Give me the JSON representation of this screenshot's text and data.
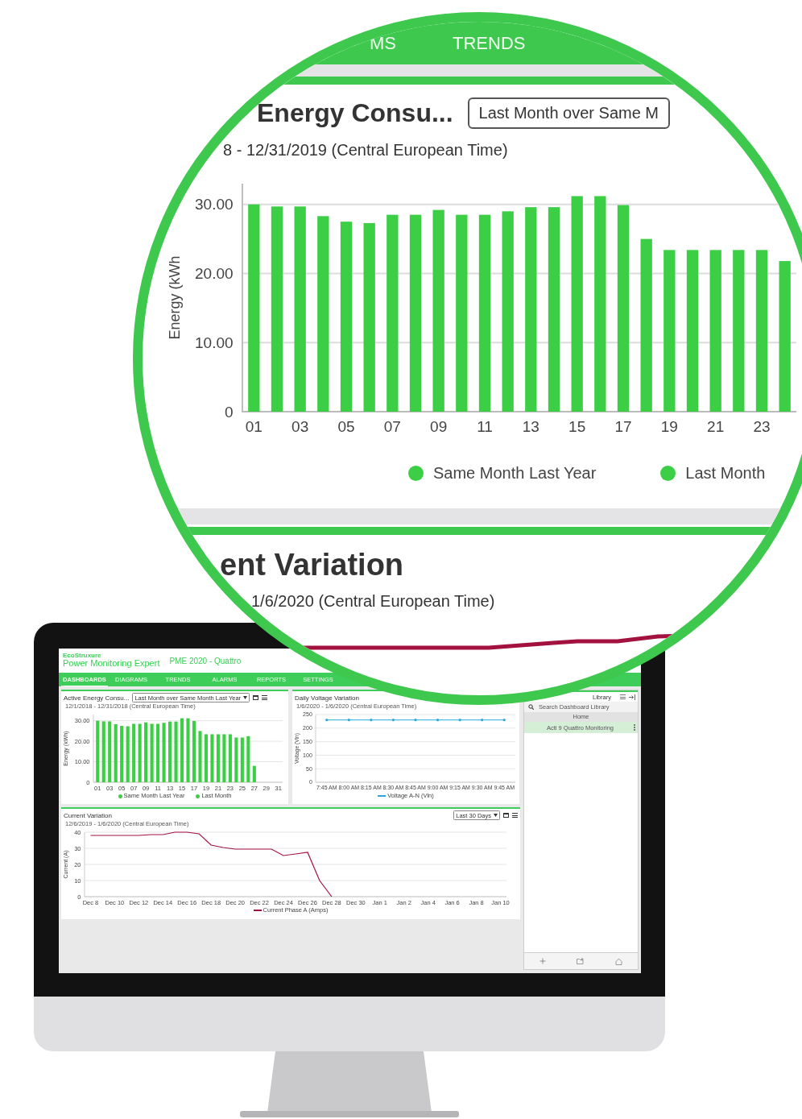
{
  "magnifier": {
    "nav_tabs": [
      {
        "label": "MS"
      },
      {
        "label": "TRENDS"
      }
    ],
    "energy_card": {
      "title": "Energy Consu...",
      "period_select": "Last Month over Same M",
      "date_range": "8 - 12/31/2019 (Central European Time)",
      "chart_data": {
        "type": "bar",
        "ylabel": "Energy (kWh",
        "grid": true,
        "x": [
          1,
          2,
          3,
          4,
          5,
          6,
          7,
          8,
          9,
          10,
          11,
          12,
          13,
          14,
          15,
          16,
          17,
          18,
          19,
          20,
          21,
          22,
          23,
          24
        ],
        "xlim": [
          0.5,
          24.5
        ],
        "ylim": [
          0,
          33
        ],
        "xticks": [
          {
            "value": 1,
            "label": "01"
          },
          {
            "value": 3,
            "label": "03"
          },
          {
            "value": 5,
            "label": "05"
          },
          {
            "value": 7,
            "label": "07"
          },
          {
            "value": 9,
            "label": "09"
          },
          {
            "value": 11,
            "label": "11"
          },
          {
            "value": 13,
            "label": "13"
          },
          {
            "value": 15,
            "label": "15"
          },
          {
            "value": 17,
            "label": "17"
          },
          {
            "value": 19,
            "label": "19"
          },
          {
            "value": 21,
            "label": "21"
          },
          {
            "value": 23,
            "label": "23"
          }
        ],
        "yticks": [
          {
            "value": 0,
            "label": "0"
          },
          {
            "value": 10,
            "label": "10.00"
          },
          {
            "value": 20,
            "label": "20.00"
          },
          {
            "value": 30,
            "label": "30.00"
          }
        ],
        "series": [
          {
            "color": "#3ccf45",
            "values": [
              30,
              29.7,
              29.7,
              28.3,
              27.5,
              27.3,
              28.5,
              28.5,
              29.2,
              28.5,
              28.5,
              29,
              29.6,
              29.6,
              31.2,
              31.2,
              29.9,
              25,
              23.4,
              23.4,
              23.4,
              23.4,
              23.4,
              21.8
            ]
          }
        ]
      },
      "legend": [
        {
          "label": "Same Month Last Year",
          "color": "#3ccf45"
        },
        {
          "label": "Last Month",
          "color": "#3ccf45"
        }
      ]
    },
    "current_card": {
      "title": "ent Variation",
      "date_range": "1/6/2020 (Central European Time)"
    }
  },
  "monitor": {
    "logo": "EcoStruxure",
    "product": "Power Monitoring Expert",
    "system_name": "PME 2020 - Quattro",
    "tabs": [
      {
        "label": "DASHBOARDS",
        "selected": true
      },
      {
        "label": "DIAGRAMS",
        "selected": false
      },
      {
        "label": "TRENDS",
        "selected": false
      },
      {
        "label": "ALARMS",
        "selected": false
      },
      {
        "label": "REPORTS",
        "selected": false
      },
      {
        "label": "SETTINGS",
        "selected": false
      }
    ],
    "energy_card": {
      "title": "Active Energy Consu...",
      "period_select": "Last Month over Same Month Last Year",
      "date_range": "12/1/2018 - 12/31/2018 (Central European Time)",
      "chart_data": {
        "type": "bar",
        "ylabel": "Energy (kWh)",
        "grid": true,
        "x": [
          1,
          2,
          3,
          4,
          5,
          6,
          7,
          8,
          9,
          10,
          11,
          12,
          13,
          14,
          15,
          16,
          17,
          18,
          19,
          20,
          21,
          22,
          23,
          24,
          25,
          26,
          27
        ],
        "xlim": [
          0.3,
          31.7
        ],
        "ylim": [
          0,
          33
        ],
        "xticks": [
          {
            "value": 1,
            "label": "01"
          },
          {
            "value": 3,
            "label": "03"
          },
          {
            "value": 5,
            "label": "05"
          },
          {
            "value": 7,
            "label": "07"
          },
          {
            "value": 9,
            "label": "09"
          },
          {
            "value": 11,
            "label": "11"
          },
          {
            "value": 13,
            "label": "13"
          },
          {
            "value": 15,
            "label": "15"
          },
          {
            "value": 17,
            "label": "17"
          },
          {
            "value": 19,
            "label": "19"
          },
          {
            "value": 21,
            "label": "21"
          },
          {
            "value": 23,
            "label": "23"
          },
          {
            "value": 25,
            "label": "25"
          },
          {
            "value": 27,
            "label": "27"
          },
          {
            "value": 29,
            "label": "29"
          },
          {
            "value": 31,
            "label": "31"
          }
        ],
        "yticks": [
          {
            "value": 0,
            "label": "0"
          },
          {
            "value": 10,
            "label": "10.00"
          },
          {
            "value": 20,
            "label": "20.00"
          },
          {
            "value": 30,
            "label": "30.00"
          }
        ],
        "series": [
          {
            "color": "#3ccf45",
            "values": [
              30,
              29.7,
              29.7,
              28.3,
              27.5,
              27.3,
              28.5,
              28.5,
              29.2,
              28.5,
              28.5,
              29,
              29.6,
              29.6,
              31.2,
              31.2,
              29.9,
              25,
              23.4,
              23.4,
              23.4,
              23.4,
              23.4,
              21.8,
              21.8,
              22.5,
              8
            ]
          }
        ]
      },
      "legend": [
        {
          "label": "Same Month Last Year",
          "color": "#3ccf45"
        },
        {
          "label": "Last Month",
          "color": "#3ccf45"
        }
      ]
    },
    "voltage_card": {
      "title": "Daily Voltage Variation",
      "date_range": "1/6/2020 - 1/6/2020 (Central European Time)",
      "chart_data": {
        "type": "line",
        "ylabel": "Voltage (Vln)",
        "grid": true,
        "categories": [
          "7:45 AM",
          "8:00 AM",
          "8:15 AM",
          "8:30 AM",
          "8:45 AM",
          "9:00 AM",
          "9:15 AM",
          "9:30 AM",
          "9:45 AM"
        ],
        "ylim": [
          0,
          250
        ],
        "yticks": [
          0,
          50,
          100,
          150,
          200,
          250
        ],
        "series": [
          {
            "color": "#29a9e0",
            "values": [
              230,
              230,
              230,
              230,
              230,
              230,
              230,
              230,
              230
            ]
          }
        ]
      },
      "legend": [
        {
          "label": "Voltage A-N (Vln)",
          "color": "#29a9e0"
        }
      ]
    },
    "current_card": {
      "title": "Current Variation",
      "period_select": "Last 30 Days",
      "date_range": "12/6/2019 - 1/6/2020 (Central European Time)",
      "chart_data": {
        "type": "line",
        "ylabel": "Current (A)",
        "grid": true,
        "categories": [
          "Dec 8",
          null,
          "Dec 10",
          null,
          "Dec 12",
          null,
          "Dec 14",
          null,
          "Dec 16",
          null,
          "Dec 18",
          null,
          "Dec 20",
          null,
          "Dec 22",
          null,
          "Dec 24",
          null,
          "Dec 26",
          null,
          "Dec 28",
          null,
          "Dec 30",
          null,
          "Jan 1",
          null,
          "Jan 2",
          null,
          "Jan 4",
          null,
          "Jan 6",
          null,
          "Jan 8",
          null,
          "Jan 10"
        ],
        "ylim": [
          0,
          40
        ],
        "yticks": [
          0,
          10,
          20,
          30,
          40
        ],
        "series": [
          {
            "color": "#a3123f",
            "values": [
              38,
              38,
              38,
              38,
              38,
              38.5,
              38.5,
              40,
              40,
              39,
              32,
              30.5,
              29.5,
              29.5,
              29.5,
              29.5,
              25.5,
              26.5,
              27.5,
              10,
              0,
              null,
              null,
              null,
              null,
              null,
              null,
              null,
              null,
              null,
              null,
              null,
              null,
              null,
              null
            ]
          }
        ]
      },
      "legend": [
        {
          "label": "Current Phase A (Amps)",
          "color": "#a3123f"
        }
      ]
    },
    "library": {
      "title": "Library",
      "search_placeholder": "Search Dashboard Library",
      "breadcrumb": "Home",
      "items": [
        {
          "label": "Acti 9 Quattro Monitoring",
          "selected": true
        }
      ]
    }
  }
}
